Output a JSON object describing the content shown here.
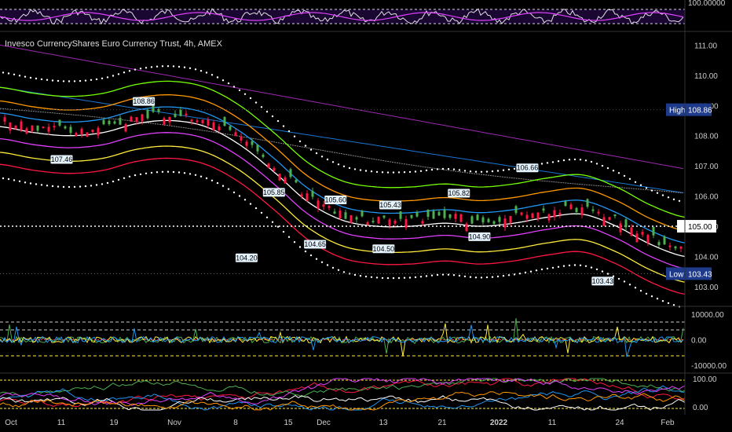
{
  "chart_data": {
    "type": "candlestick",
    "title": "Invesco CurrencyShares Euro Currency Trust, 4h, AMEX",
    "price_axis": {
      "ticks": [
        "111.00",
        "110.00",
        "109.00",
        "108.00",
        "107.00",
        "106.00",
        "105.00",
        "104.00",
        "103.00"
      ],
      "ylim": [
        102.4,
        111.4
      ]
    },
    "current_price": "105.00",
    "high": {
      "label": "High",
      "value": "108.86"
    },
    "low": {
      "label": "Low",
      "value": "103.43"
    },
    "annotations": [
      {
        "text": "108.86",
        "x": 0.21,
        "y": 108.86,
        "pos": "above"
      },
      {
        "text": "107.46",
        "x": 0.09,
        "y": 107.46,
        "pos": "below"
      },
      {
        "text": "104.20",
        "x": 0.36,
        "y": 104.2,
        "pos": "below"
      },
      {
        "text": "105.85",
        "x": 0.4,
        "y": 105.85,
        "pos": "above"
      },
      {
        "text": "105.60",
        "x": 0.49,
        "y": 105.6,
        "pos": "above"
      },
      {
        "text": "104.65",
        "x": 0.46,
        "y": 104.65,
        "pos": "below"
      },
      {
        "text": "105.43",
        "x": 0.57,
        "y": 105.43,
        "pos": "above"
      },
      {
        "text": "104.50",
        "x": 0.56,
        "y": 104.5,
        "pos": "below"
      },
      {
        "text": "105.82",
        "x": 0.67,
        "y": 105.82,
        "pos": "above"
      },
      {
        "text": "104.90",
        "x": 0.7,
        "y": 104.9,
        "pos": "below"
      },
      {
        "text": "106.66",
        "x": 0.77,
        "y": 106.66,
        "pos": "above"
      },
      {
        "text": "103.43",
        "x": 0.88,
        "y": 103.43,
        "pos": "below"
      }
    ],
    "x_axis_labels": [
      "Oct",
      "11",
      "19",
      "Nov",
      "8",
      "15",
      "Dec",
      "13",
      "21",
      "2022",
      "11",
      "24",
      "Feb"
    ],
    "centerline": [
      108.5,
      108.3,
      108.2,
      108.3,
      108.6,
      108.7,
      108.5,
      107.9,
      107.0,
      106.0,
      105.4,
      105.2,
      105.2,
      105.3,
      105.2,
      105.3,
      105.5,
      105.6,
      105.2,
      104.6,
      104.2
    ],
    "rsi_panel": {
      "ticks": [
        "100.00000"
      ]
    },
    "osc_panel": {
      "ticks": [
        "10000.00",
        "0.00",
        "-10000.00"
      ]
    },
    "bottom_panel": {
      "ticks": [
        "100.00",
        "0.00"
      ]
    },
    "colors": {
      "up": "#4caf50",
      "down": "#ff1744",
      "bands": [
        "#ff1744",
        "#ffeb3b",
        "#e040fb",
        "#ffffff",
        "#2196f3",
        "#ff9800",
        "#76ff03"
      ],
      "dots": "#ffffff",
      "slow_ma": "#9c27b0",
      "slow_ma2": "#1976d2",
      "tag_bg": "#1e3a8a"
    }
  }
}
